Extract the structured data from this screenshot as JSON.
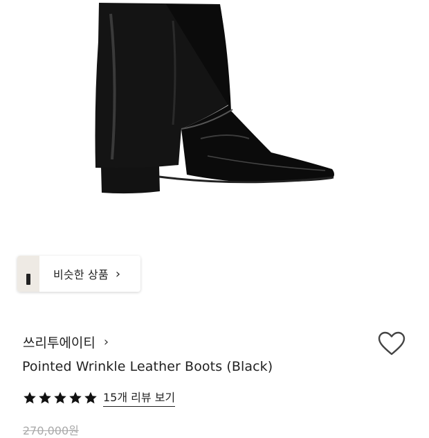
{
  "similar": {
    "label": "비슷한 상품",
    "chevron": "›"
  },
  "product": {
    "brand": "쓰리투에이티",
    "brand_chevron": "›",
    "title": "Pointed Wrinkle Leather Boots (Black)",
    "rating": 5,
    "review_link": "15개 리뷰 보기",
    "original_price": "270,000원"
  },
  "icons": {
    "favorite": "heart-outline-icon",
    "rating": "star-filled-icon"
  },
  "colors": {
    "text": "#222222",
    "muted": "#aaaaaa",
    "boot": "#0d0d0d"
  }
}
